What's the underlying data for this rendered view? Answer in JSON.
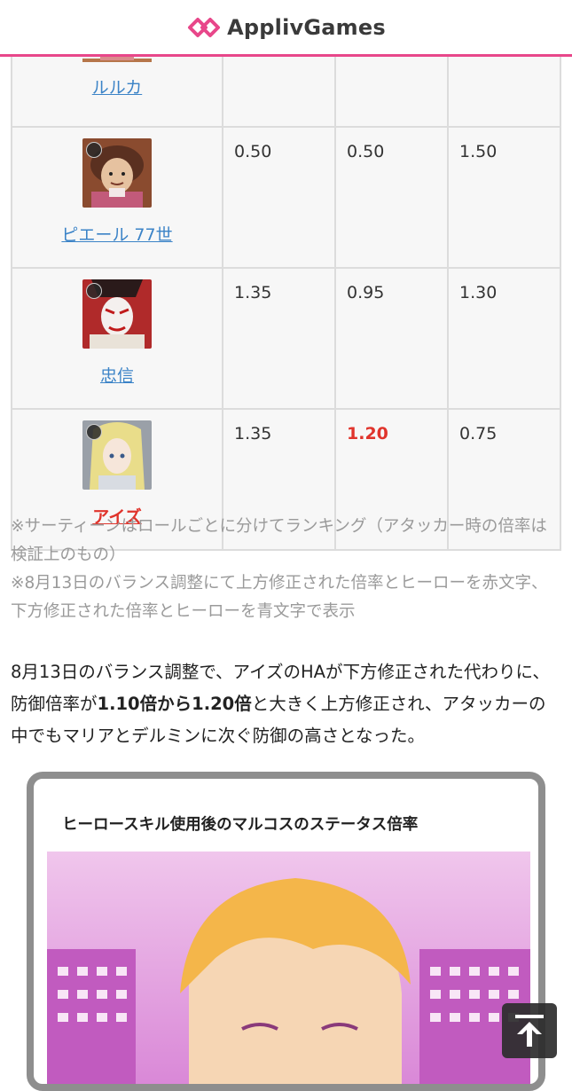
{
  "header": {
    "logo_text": "ApplivGames",
    "brand_color": "#e8478a"
  },
  "table": {
    "rows": [
      {
        "name": "ルルカ",
        "highlight": false,
        "values": [
          "",
          "",
          ""
        ],
        "value_colors": [
          "",
          "",
          ""
        ]
      },
      {
        "name": "ピエール 77世",
        "highlight": false,
        "values": [
          "0.50",
          "0.50",
          "1.50"
        ],
        "value_colors": [
          "",
          "",
          ""
        ]
      },
      {
        "name": "忠信",
        "highlight": false,
        "values": [
          "1.35",
          "0.95",
          "1.30"
        ],
        "value_colors": [
          "",
          "",
          ""
        ]
      },
      {
        "name": "アイズ",
        "highlight": true,
        "values": [
          "1.35",
          "1.20",
          "0.75"
        ],
        "value_colors": [
          "",
          "red",
          ""
        ]
      }
    ],
    "highlight_color": "#e0342c",
    "link_color": "#3b83c7"
  },
  "notes": {
    "line1": "※サーティーンはロールごとに分けてランキング（アタッカー時の倍率は検証上のもの）",
    "line2": "※8月13日のバランス調整にて上方修正された倍率とヒーローを赤文字、下方修正された倍率とヒーローを青文字で表示"
  },
  "paragraph": {
    "part1": "8月13日のバランス調整で、アイズのHAが下方修正された代わりに、防御倍率が",
    "bold": "1.10倍から1.20倍",
    "part2": "と大きく上方修正され、アタッカーの中でもマリアとデルミンに次ぐ防御の高さとなった。"
  },
  "card": {
    "title": "ヒーロースキル使用後のマルコスのステータス倍率"
  },
  "icons": {
    "back_to_top": "arrow-up-to-top-icon",
    "logo": "applivgames-logo-icon"
  }
}
